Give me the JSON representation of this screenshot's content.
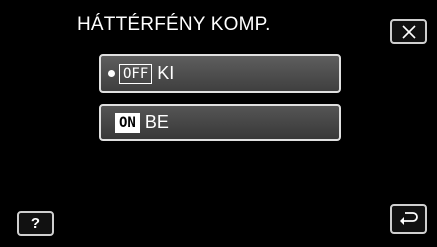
{
  "title": "HÁTTÉRFÉNY KOMP.",
  "options": [
    {
      "badge": "OFF",
      "label": "KI",
      "selected": true
    },
    {
      "badge": "ON",
      "label": "BE",
      "selected": false
    }
  ],
  "help_label": "?",
  "icons": {
    "close": "close-icon",
    "back": "return-icon",
    "selected": "selected-dot-icon"
  }
}
